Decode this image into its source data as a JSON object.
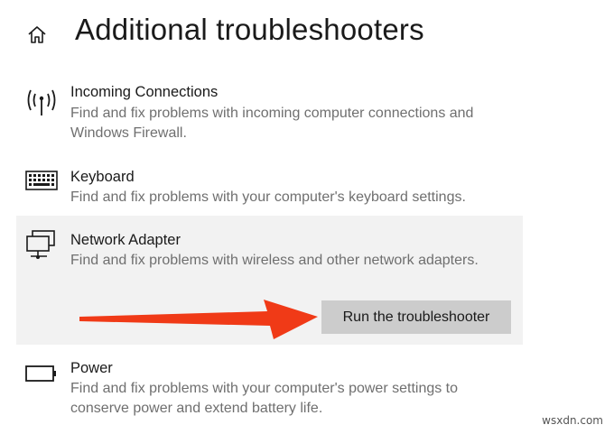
{
  "header": {
    "title": "Additional troubleshooters",
    "home_icon": "home-icon"
  },
  "items": [
    {
      "title": "Incoming Connections",
      "description": "Find and fix problems with incoming computer connections and Windows Firewall.",
      "icon": "antenna-icon"
    },
    {
      "title": "Keyboard",
      "description": "Find and fix problems with your computer's keyboard settings.",
      "icon": "keyboard-icon"
    },
    {
      "title": "Network Adapter",
      "description": "Find and fix problems with wireless and other network adapters.",
      "icon": "network-adapter-icon",
      "button_label": "Run the troubleshooter",
      "selected": true
    },
    {
      "title": "Power",
      "description": "Find and fix problems with your computer's power settings to conserve power and extend battery life.",
      "icon": "battery-icon"
    }
  ],
  "annotation": {
    "arrow_color": "#f03a17"
  },
  "watermark": "wsxdn.com",
  "colors": {
    "selected_background": "#f2f2f2",
    "button_background": "#cccccc",
    "description_text": "#6f6f6f"
  }
}
